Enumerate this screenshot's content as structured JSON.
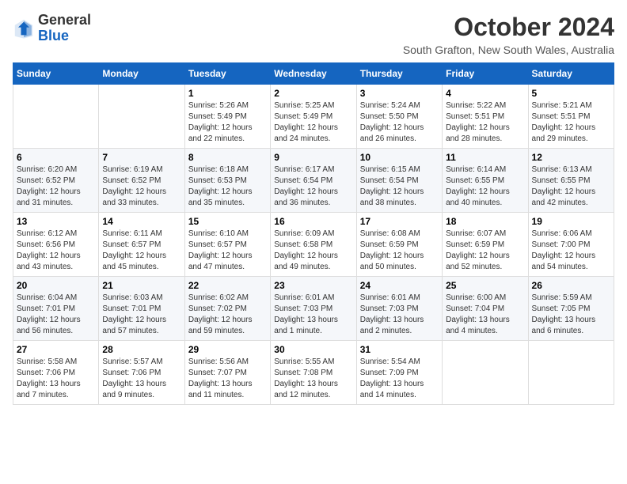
{
  "logo": {
    "text_general": "General",
    "text_blue": "Blue"
  },
  "header": {
    "month": "October 2024",
    "location": "South Grafton, New South Wales, Australia"
  },
  "weekdays": [
    "Sunday",
    "Monday",
    "Tuesday",
    "Wednesday",
    "Thursday",
    "Friday",
    "Saturday"
  ],
  "weeks": [
    [
      {
        "day": "",
        "sunrise": "",
        "sunset": "",
        "daylight": ""
      },
      {
        "day": "",
        "sunrise": "",
        "sunset": "",
        "daylight": ""
      },
      {
        "day": "1",
        "sunrise": "Sunrise: 5:26 AM",
        "sunset": "Sunset: 5:49 PM",
        "daylight": "Daylight: 12 hours and 22 minutes."
      },
      {
        "day": "2",
        "sunrise": "Sunrise: 5:25 AM",
        "sunset": "Sunset: 5:49 PM",
        "daylight": "Daylight: 12 hours and 24 minutes."
      },
      {
        "day": "3",
        "sunrise": "Sunrise: 5:24 AM",
        "sunset": "Sunset: 5:50 PM",
        "daylight": "Daylight: 12 hours and 26 minutes."
      },
      {
        "day": "4",
        "sunrise": "Sunrise: 5:22 AM",
        "sunset": "Sunset: 5:51 PM",
        "daylight": "Daylight: 12 hours and 28 minutes."
      },
      {
        "day": "5",
        "sunrise": "Sunrise: 5:21 AM",
        "sunset": "Sunset: 5:51 PM",
        "daylight": "Daylight: 12 hours and 29 minutes."
      }
    ],
    [
      {
        "day": "6",
        "sunrise": "Sunrise: 6:20 AM",
        "sunset": "Sunset: 6:52 PM",
        "daylight": "Daylight: 12 hours and 31 minutes."
      },
      {
        "day": "7",
        "sunrise": "Sunrise: 6:19 AM",
        "sunset": "Sunset: 6:52 PM",
        "daylight": "Daylight: 12 hours and 33 minutes."
      },
      {
        "day": "8",
        "sunrise": "Sunrise: 6:18 AM",
        "sunset": "Sunset: 6:53 PM",
        "daylight": "Daylight: 12 hours and 35 minutes."
      },
      {
        "day": "9",
        "sunrise": "Sunrise: 6:17 AM",
        "sunset": "Sunset: 6:54 PM",
        "daylight": "Daylight: 12 hours and 36 minutes."
      },
      {
        "day": "10",
        "sunrise": "Sunrise: 6:15 AM",
        "sunset": "Sunset: 6:54 PM",
        "daylight": "Daylight: 12 hours and 38 minutes."
      },
      {
        "day": "11",
        "sunrise": "Sunrise: 6:14 AM",
        "sunset": "Sunset: 6:55 PM",
        "daylight": "Daylight: 12 hours and 40 minutes."
      },
      {
        "day": "12",
        "sunrise": "Sunrise: 6:13 AM",
        "sunset": "Sunset: 6:55 PM",
        "daylight": "Daylight: 12 hours and 42 minutes."
      }
    ],
    [
      {
        "day": "13",
        "sunrise": "Sunrise: 6:12 AM",
        "sunset": "Sunset: 6:56 PM",
        "daylight": "Daylight: 12 hours and 43 minutes."
      },
      {
        "day": "14",
        "sunrise": "Sunrise: 6:11 AM",
        "sunset": "Sunset: 6:57 PM",
        "daylight": "Daylight: 12 hours and 45 minutes."
      },
      {
        "day": "15",
        "sunrise": "Sunrise: 6:10 AM",
        "sunset": "Sunset: 6:57 PM",
        "daylight": "Daylight: 12 hours and 47 minutes."
      },
      {
        "day": "16",
        "sunrise": "Sunrise: 6:09 AM",
        "sunset": "Sunset: 6:58 PM",
        "daylight": "Daylight: 12 hours and 49 minutes."
      },
      {
        "day": "17",
        "sunrise": "Sunrise: 6:08 AM",
        "sunset": "Sunset: 6:59 PM",
        "daylight": "Daylight: 12 hours and 50 minutes."
      },
      {
        "day": "18",
        "sunrise": "Sunrise: 6:07 AM",
        "sunset": "Sunset: 6:59 PM",
        "daylight": "Daylight: 12 hours and 52 minutes."
      },
      {
        "day": "19",
        "sunrise": "Sunrise: 6:06 AM",
        "sunset": "Sunset: 7:00 PM",
        "daylight": "Daylight: 12 hours and 54 minutes."
      }
    ],
    [
      {
        "day": "20",
        "sunrise": "Sunrise: 6:04 AM",
        "sunset": "Sunset: 7:01 PM",
        "daylight": "Daylight: 12 hours and 56 minutes."
      },
      {
        "day": "21",
        "sunrise": "Sunrise: 6:03 AM",
        "sunset": "Sunset: 7:01 PM",
        "daylight": "Daylight: 12 hours and 57 minutes."
      },
      {
        "day": "22",
        "sunrise": "Sunrise: 6:02 AM",
        "sunset": "Sunset: 7:02 PM",
        "daylight": "Daylight: 12 hours and 59 minutes."
      },
      {
        "day": "23",
        "sunrise": "Sunrise: 6:01 AM",
        "sunset": "Sunset: 7:03 PM",
        "daylight": "Daylight: 13 hours and 1 minute."
      },
      {
        "day": "24",
        "sunrise": "Sunrise: 6:01 AM",
        "sunset": "Sunset: 7:03 PM",
        "daylight": "Daylight: 13 hours and 2 minutes."
      },
      {
        "day": "25",
        "sunrise": "Sunrise: 6:00 AM",
        "sunset": "Sunset: 7:04 PM",
        "daylight": "Daylight: 13 hours and 4 minutes."
      },
      {
        "day": "26",
        "sunrise": "Sunrise: 5:59 AM",
        "sunset": "Sunset: 7:05 PM",
        "daylight": "Daylight: 13 hours and 6 minutes."
      }
    ],
    [
      {
        "day": "27",
        "sunrise": "Sunrise: 5:58 AM",
        "sunset": "Sunset: 7:06 PM",
        "daylight": "Daylight: 13 hours and 7 minutes."
      },
      {
        "day": "28",
        "sunrise": "Sunrise: 5:57 AM",
        "sunset": "Sunset: 7:06 PM",
        "daylight": "Daylight: 13 hours and 9 minutes."
      },
      {
        "day": "29",
        "sunrise": "Sunrise: 5:56 AM",
        "sunset": "Sunset: 7:07 PM",
        "daylight": "Daylight: 13 hours and 11 minutes."
      },
      {
        "day": "30",
        "sunrise": "Sunrise: 5:55 AM",
        "sunset": "Sunset: 7:08 PM",
        "daylight": "Daylight: 13 hours and 12 minutes."
      },
      {
        "day": "31",
        "sunrise": "Sunrise: 5:54 AM",
        "sunset": "Sunset: 7:09 PM",
        "daylight": "Daylight: 13 hours and 14 minutes."
      },
      {
        "day": "",
        "sunrise": "",
        "sunset": "",
        "daylight": ""
      },
      {
        "day": "",
        "sunrise": "",
        "sunset": "",
        "daylight": ""
      }
    ]
  ]
}
